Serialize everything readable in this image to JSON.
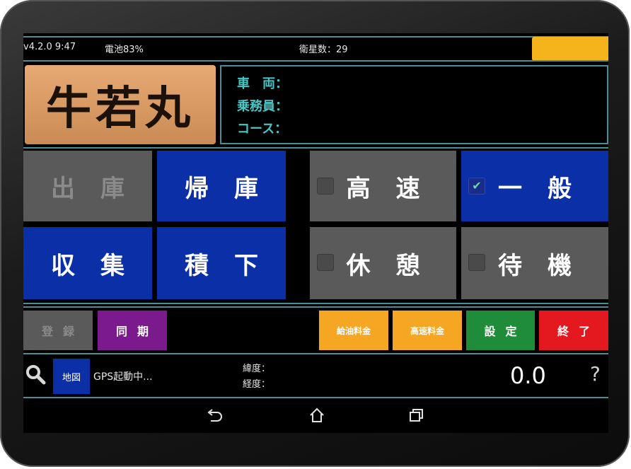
{
  "status": {
    "version_time": "v4.2.0  9:47",
    "battery": "電池83%",
    "satellites": "衛星数：29"
  },
  "logo_text": "牛若丸",
  "info": {
    "vehicle": "車　両：",
    "crew": "乗務員：",
    "course": "コース："
  },
  "buttons": {
    "depart": "出庫",
    "return": "帰庫",
    "highway": "高速",
    "general": "一般",
    "collect": "収集",
    "unload": "積下",
    "rest": "休憩",
    "standby": "待機"
  },
  "checks": {
    "highway_checked": false,
    "general_checked": true,
    "rest_checked": false,
    "standby_checked": false,
    "check_mark": "✔"
  },
  "actions": {
    "register": "登録",
    "sync": "同期",
    "fuel_fee": "給油料金",
    "highway_fee": "高速料金",
    "settings": "設定",
    "exit": "終了"
  },
  "footer": {
    "map": "地図",
    "gps_status": "GPS起動中...",
    "latitude": "緯度：",
    "longitude": "経度：",
    "speed": "0.0",
    "help": "?"
  },
  "colors": {
    "blue": "#0b2fa6",
    "gray": "#5a5a5a",
    "purple": "#7a1a8c",
    "orange": "#f5a623",
    "green": "#1f8c3a",
    "red": "#e3191f",
    "teal_line": "#4a8c98",
    "battery": "#f5b41c"
  },
  "icons": {
    "search": "search-icon",
    "back": "back-icon",
    "home": "home-icon",
    "recents": "recents-icon"
  }
}
